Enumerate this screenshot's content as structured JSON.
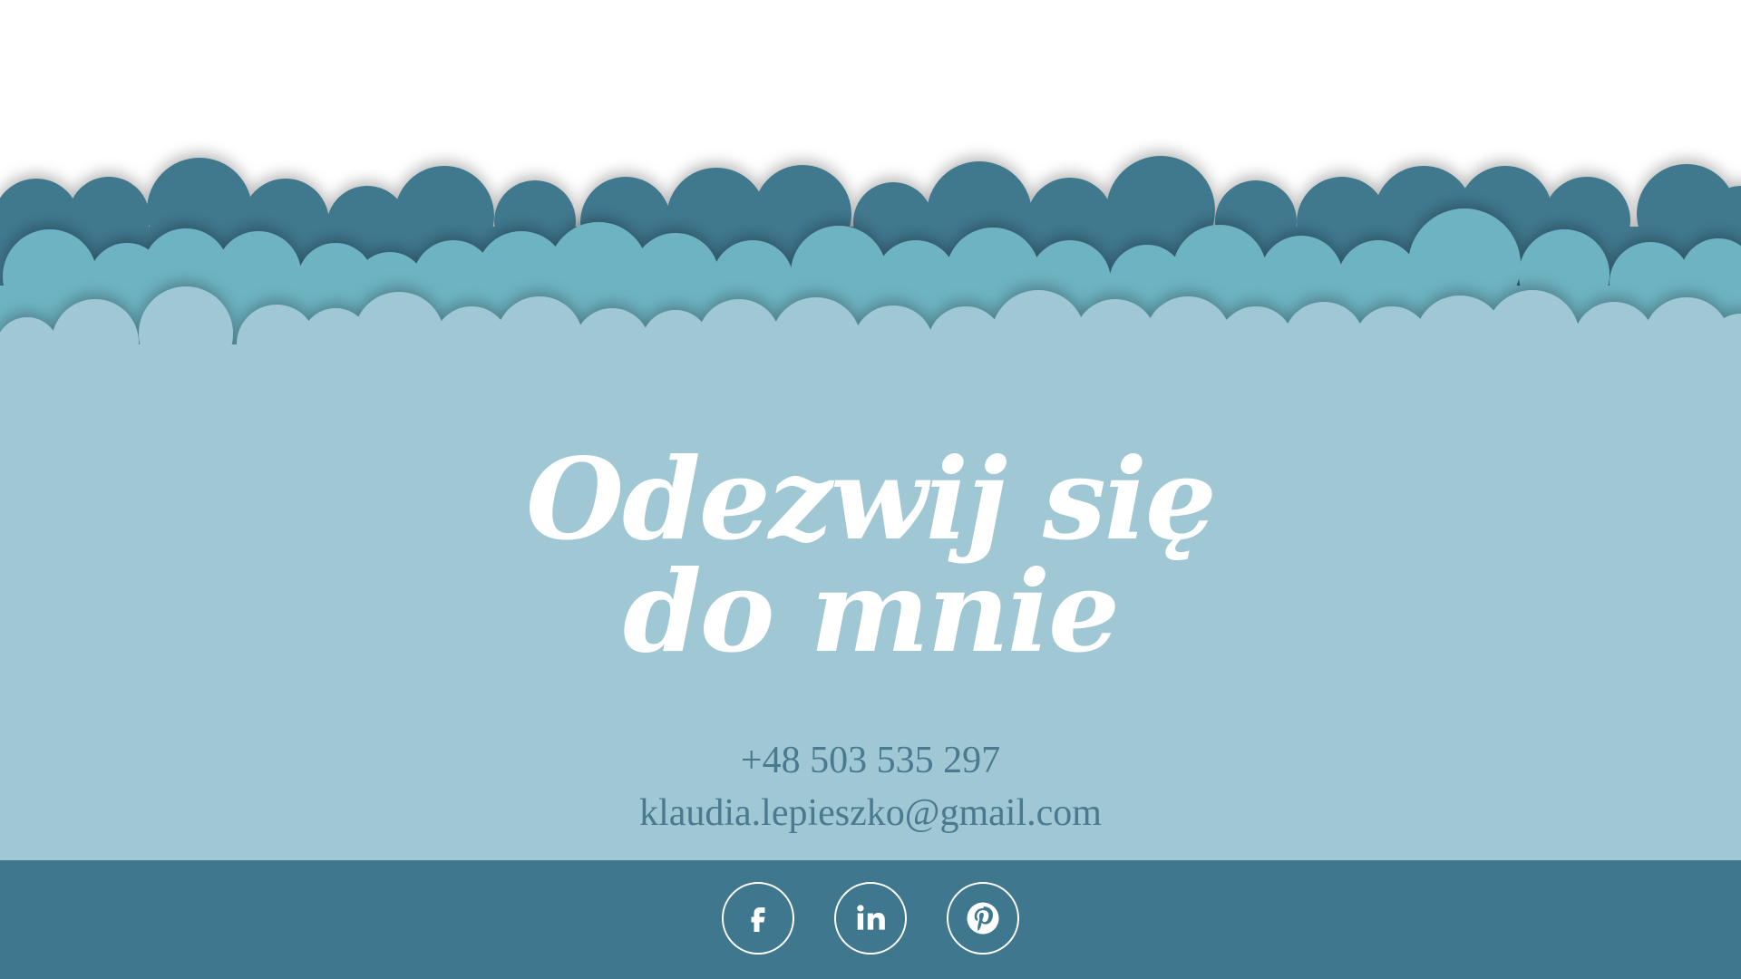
{
  "colors": {
    "cloud_dark": "#3f788e",
    "cloud_mid": "#6db3c1",
    "cloud_light": "#9fc7d4",
    "footer": "#3f788e",
    "contact_text": "#4a7a90",
    "heading_text": "#ffffff"
  },
  "contact": {
    "heading_line_1": "Odezwij się",
    "heading_line_2": "do mnie",
    "phone": "+48 503 535 297",
    "email": "klaudia.lepieszko@gmail.com"
  },
  "social": {
    "facebook_icon": "facebook-icon",
    "linkedin_icon": "linkedin-icon",
    "pinterest_icon": "pinterest-icon"
  }
}
